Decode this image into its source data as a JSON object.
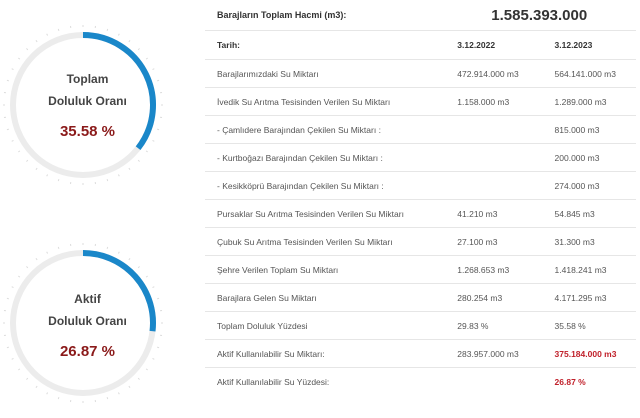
{
  "gauges": [
    {
      "label_line1": "Toplam",
      "label_line2": "Doluluk Oranı",
      "value_text": "35.58 %",
      "percent": 35.58
    },
    {
      "label_line1": "Aktif",
      "label_line2": "Doluluk Oranı",
      "value_text": "26.87 %",
      "percent": 26.87
    }
  ],
  "colors": {
    "gauge_fill": "#1a87c9",
    "gauge_track": "#ececec",
    "value_text": "#8b1a1a",
    "highlight": "#c0202a"
  },
  "table": {
    "title_label": "Barajların Toplam Hacmi (m3):",
    "title_value": "1.585.393.000",
    "date_label": "Tarih:",
    "date_1": "3.12.2022",
    "date_2": "3.12.2023",
    "rows": [
      {
        "label": "Barajlarımızdaki Su Miktarı",
        "v1": "472.914.000 m3",
        "v2": "564.141.000 m3"
      },
      {
        "label": "İvedik Su Arıtma Tesisinden Verilen Su Miktarı",
        "v1": "1.158.000 m3",
        "v2": "1.289.000 m3"
      },
      {
        "label": "- Çamlıdere Barajından Çekilen Su Miktarı :",
        "v1": "",
        "v2": "815.000 m3"
      },
      {
        "label": "- Kurtboğazı Barajından Çekilen Su Miktarı :",
        "v1": "",
        "v2": "200.000 m3"
      },
      {
        "label": "- Kesikköprü Barajından Çekilen Su Miktarı :",
        "v1": "",
        "v2": "274.000 m3"
      },
      {
        "label": "Pursaklar Su Arıtma Tesisinden Verilen Su Miktarı",
        "v1": "41.210 m3",
        "v2": "54.845 m3"
      },
      {
        "label": "Çubuk Su Arıtma Tesisinden Verilen Su Miktarı",
        "v1": "27.100 m3",
        "v2": "31.300 m3"
      },
      {
        "label": "Şehre Verilen Toplam Su Miktarı",
        "v1": "1.268.653 m3",
        "v2": "1.418.241 m3"
      },
      {
        "label": "Barajlara Gelen Su Miktarı",
        "v1": "280.254 m3",
        "v2": "4.171.295 m3"
      },
      {
        "label": "Toplam Doluluk Yüzdesi",
        "v1": "29.83 %",
        "v2": "35.58 %"
      },
      {
        "label": "Aktif Kullanılabilir Su Miktarı:",
        "v1": "283.957.000 m3",
        "v2": "375.184.000 m3"
      },
      {
        "label": "Aktif Kullanılabilir Su Yüzdesi:",
        "v1": "",
        "v2": "26.87 %"
      }
    ]
  }
}
